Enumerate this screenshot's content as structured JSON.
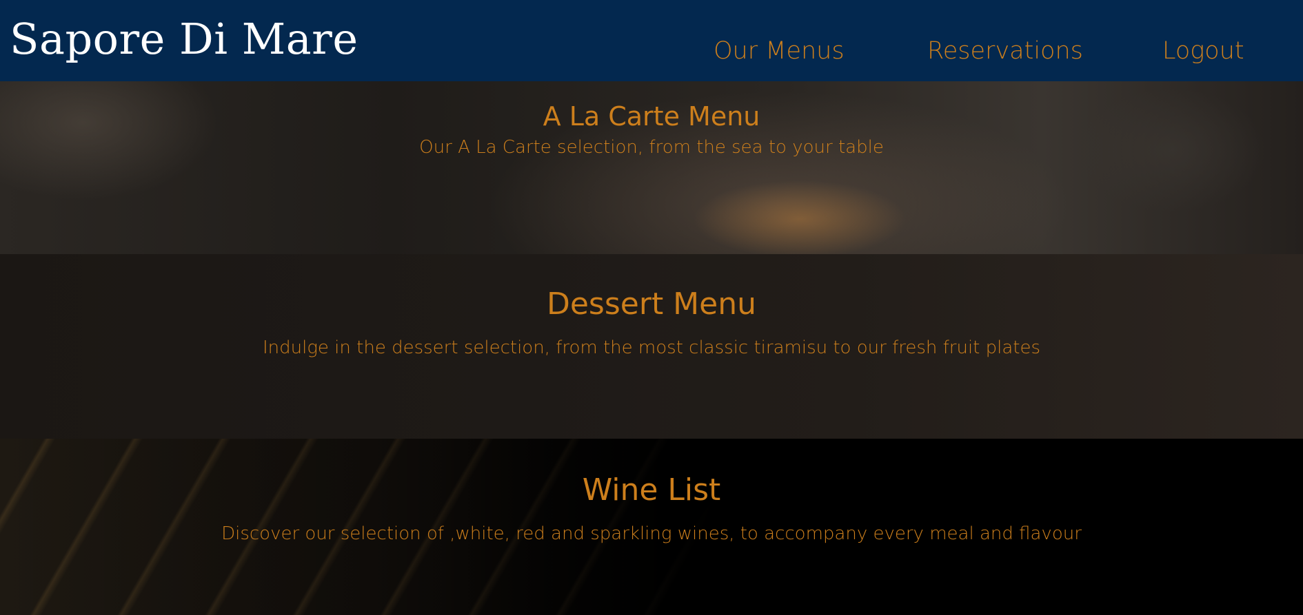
{
  "header": {
    "brand": "Sapore Di Mare",
    "nav": {
      "menus": "Our Menus",
      "reservations": "Reservations",
      "logout": "Logout"
    }
  },
  "sections": [
    {
      "title": "A La Carte Menu",
      "subtitle": "Our A La Carte selection, from the sea to your table"
    },
    {
      "title": "Dessert Menu",
      "subtitle": "Indulge in the dessert selection, from the most classic tiramisu to our fresh fruit plates"
    },
    {
      "title": "Wine List",
      "subtitle": "Discover our selection of ,white, red and sparkling wines, to accompany every meal and flavour"
    }
  ],
  "colors": {
    "header_bg": "#03284f",
    "accent": "#cd7f1c",
    "brand_text": "#ffffff"
  }
}
